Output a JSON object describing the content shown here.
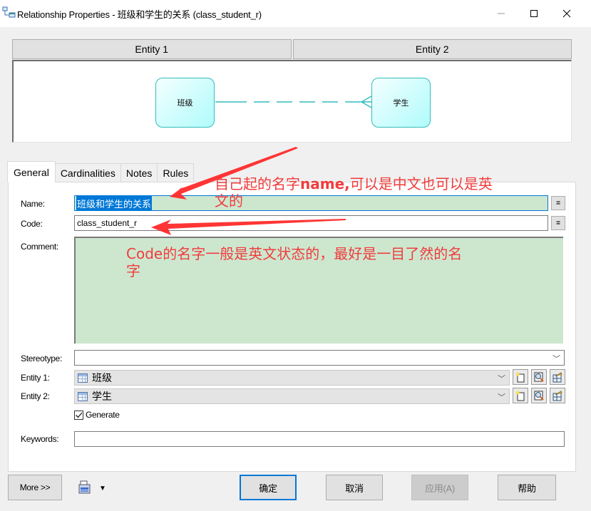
{
  "window": {
    "title": "Relationship Properties - 班级和学生的关系 (class_student_r)",
    "icon": "relationship-icon",
    "controls": {
      "minimize": "—",
      "maximize": "☐",
      "close": "✕"
    }
  },
  "diagram": {
    "header": [
      "Entity 1",
      "Entity 2"
    ],
    "entity1": "班级",
    "entity2": "学生",
    "line_color": "#35bcbc"
  },
  "tabs": [
    {
      "label": "General",
      "active": true
    },
    {
      "label": "Cardinalities",
      "active": false
    },
    {
      "label": "Notes",
      "active": false
    },
    {
      "label": "Rules",
      "active": false
    }
  ],
  "form": {
    "name_label": "Name:",
    "name_value": "班级和学生的关系",
    "code_label": "Code:",
    "code_value": "class_student_r",
    "equals_button": "=",
    "comment_label": "Comment:",
    "comment_value": "",
    "stereotype_label": "Stereotype:",
    "stereotype_value": "",
    "entity1_label": "Entity 1:",
    "entity1_value": "班级",
    "entity2_label": "Entity 2:",
    "entity2_value": "学生",
    "generate_label": "Generate",
    "generate_checked": true,
    "keywords_label": "Keywords:",
    "keywords_value": ""
  },
  "annotations": {
    "name_note_pre": "自己起的名字",
    "name_note_bold": "name,",
    "name_note_post": "可以是中文也可以是英",
    "name_note_line2": "文的",
    "code_note_bold": "Code",
    "code_note_post": "的名字一般是英文状态的，最好是一目了然的名",
    "code_note_line2": "字",
    "color": "#f03c3c"
  },
  "buttons": {
    "more": "More >>",
    "ok": "确定",
    "cancel": "取消",
    "apply": "应用(A)",
    "help": "帮助"
  }
}
